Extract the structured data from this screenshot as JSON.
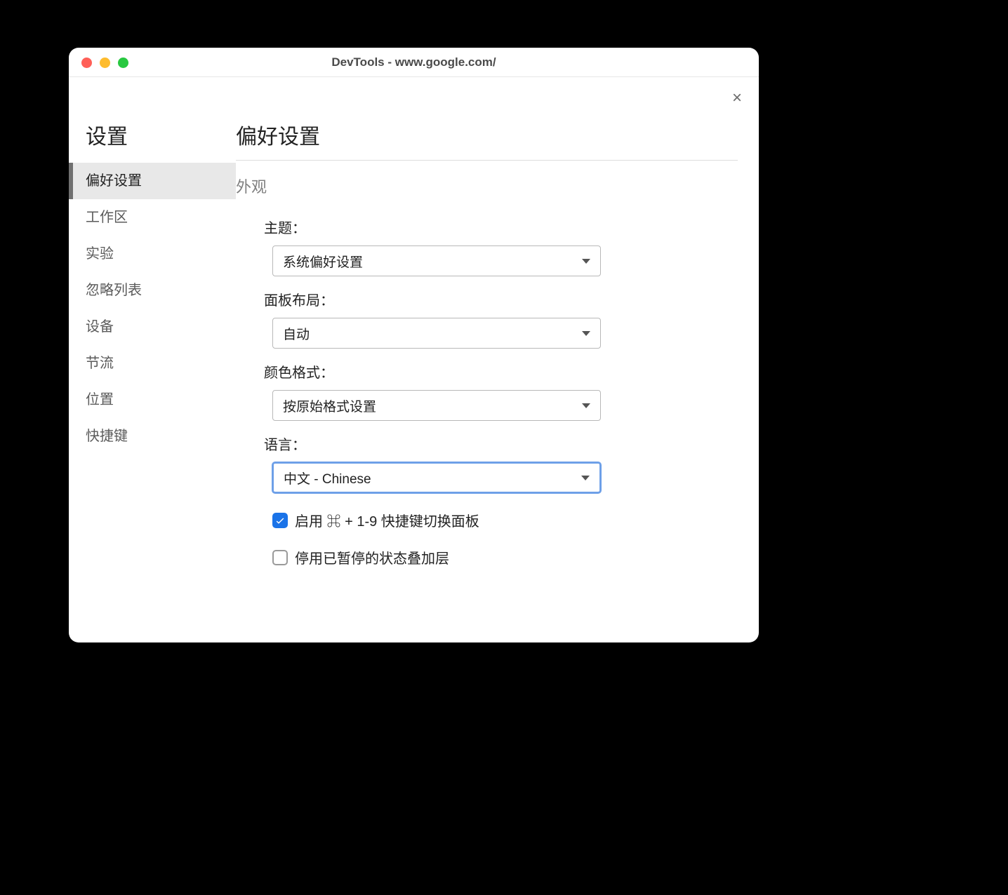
{
  "window": {
    "title": "DevTools - www.google.com/"
  },
  "close_label": "×",
  "sidebar": {
    "title": "设置",
    "items": [
      {
        "label": "偏好设置",
        "active": true
      },
      {
        "label": "工作区",
        "active": false
      },
      {
        "label": "实验",
        "active": false
      },
      {
        "label": "忽略列表",
        "active": false
      },
      {
        "label": "设备",
        "active": false
      },
      {
        "label": "节流",
        "active": false
      },
      {
        "label": "位置",
        "active": false
      },
      {
        "label": "快捷键",
        "active": false
      }
    ]
  },
  "main": {
    "title": "偏好设置",
    "section": "外观",
    "fields": {
      "theme": {
        "label": "主题：",
        "value": "系统偏好设置"
      },
      "layout": {
        "label": "面板布局：",
        "value": "自动"
      },
      "color": {
        "label": "颜色格式：",
        "value": "按原始格式设置"
      },
      "lang": {
        "label": "语言：",
        "value": "中文 - Chinese"
      }
    },
    "checkboxes": {
      "shortcut": {
        "label": "启用 ⌘ + 1-9 快捷键切换面板",
        "checked": true
      },
      "overlay": {
        "label": "停用已暂停的状态叠加层",
        "checked": false
      }
    }
  }
}
